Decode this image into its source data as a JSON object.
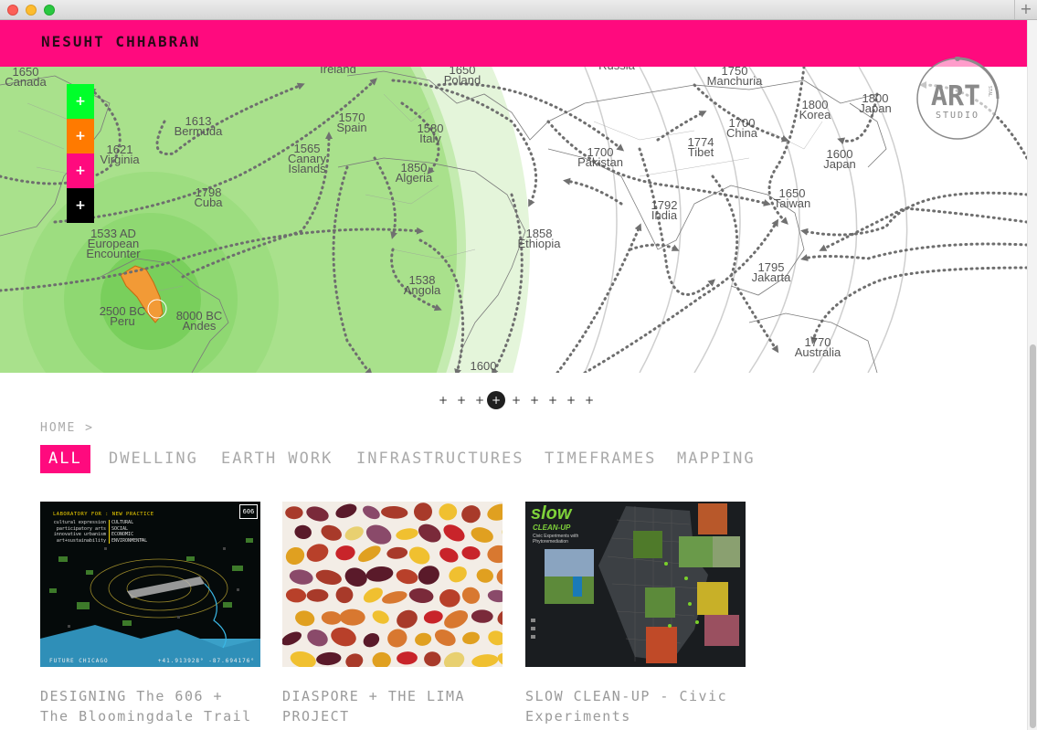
{
  "browser": {
    "new_tab_label": "+"
  },
  "header": {
    "brand_text": "NESUHT CHHABRAN",
    "bg_color": "#ff0a7e"
  },
  "side_buttons": [
    {
      "label": "+",
      "color": "#00ff2a"
    },
    {
      "label": "+",
      "color": "#ff7a00"
    },
    {
      "label": "+",
      "color": "#ff0a7e"
    },
    {
      "label": "+",
      "color": "#000000"
    }
  ],
  "logo": {
    "main": "ART",
    "sub": "STUDIO",
    "tag": "STAL"
  },
  "map": {
    "labels": [
      {
        "lines": [
          "1650",
          "Canada"
        ]
      },
      {
        "lines": [
          "1613",
          "Bermuda"
        ]
      },
      {
        "lines": [
          "1621",
          "Virginia"
        ]
      },
      {
        "lines": [
          "1798",
          "Cuba"
        ]
      },
      {
        "lines": [
          "1533 AD",
          "European",
          "Encounter"
        ]
      },
      {
        "lines": [
          "2500 BC",
          "Peru"
        ]
      },
      {
        "lines": [
          "8000 BC",
          "Andes"
        ]
      },
      {
        "lines": [
          "Ireland"
        ]
      },
      {
        "lines": [
          "1650",
          "Poland"
        ]
      },
      {
        "lines": [
          "1570",
          "Spain"
        ]
      },
      {
        "lines": [
          "1580",
          "Italy"
        ]
      },
      {
        "lines": [
          "1565",
          "Canary",
          "Islands"
        ]
      },
      {
        "lines": [
          "1850",
          "Algeria"
        ]
      },
      {
        "lines": [
          "1858",
          "Ethiopia"
        ]
      },
      {
        "lines": [
          "1538",
          "Angola"
        ]
      },
      {
        "lines": [
          "1600"
        ]
      },
      {
        "lines": [
          "Russia"
        ]
      },
      {
        "lines": [
          "1750",
          "Manchuria"
        ]
      },
      {
        "lines": [
          "1700",
          "China"
        ]
      },
      {
        "lines": [
          "1800",
          "Korea"
        ]
      },
      {
        "lines": [
          "1800",
          "Japan"
        ]
      },
      {
        "lines": [
          "1600",
          "Japan"
        ]
      },
      {
        "lines": [
          "1700",
          "Pakistan"
        ]
      },
      {
        "lines": [
          "1774",
          "Tibet"
        ]
      },
      {
        "lines": [
          "1792",
          "India"
        ]
      },
      {
        "lines": [
          "1650",
          "Taiwan"
        ]
      },
      {
        "lines": [
          "1795",
          "Jakarta"
        ]
      },
      {
        "lines": [
          "1770",
          "Australia"
        ]
      }
    ]
  },
  "slider": {
    "dots": [
      "+",
      "+",
      "+",
      "+",
      "+",
      "+",
      "+",
      "+",
      "+"
    ],
    "active_index": 3
  },
  "breadcrumb": "HOME >",
  "filters": [
    "ALL",
    "DWELLING",
    "EARTH WORK",
    "INFRASTRUCTURES",
    "TIMEFRAMES",
    "MAPPING"
  ],
  "cards": [
    {
      "title": "DESIGNING The 606 + The Bloomingdale Trail",
      "thumb": {
        "lab": "LABORATORY FOR : NEW PRACTICE",
        "left_col": [
          "cultural expression",
          "participatory arts",
          "innovative urbanism",
          "art+sustainability"
        ],
        "right_col": [
          "CULTURAL",
          "SOCIAL",
          "ECONOMIC",
          "ENVIRONMENTAL"
        ],
        "badge": "606",
        "footer_left": "FUTURE CHICAGO",
        "footer_right": "+41.913928° -87.694176°"
      }
    },
    {
      "title": "DIASPORE + THE LIMA PROJECT"
    },
    {
      "title": "SLOW CLEAN-UP - Civic Experiments",
      "thumb": {
        "word1": "slow",
        "word2": "CLEAN-UP",
        "subtitle": "Civic Experiments with Phytoremediation"
      }
    }
  ]
}
